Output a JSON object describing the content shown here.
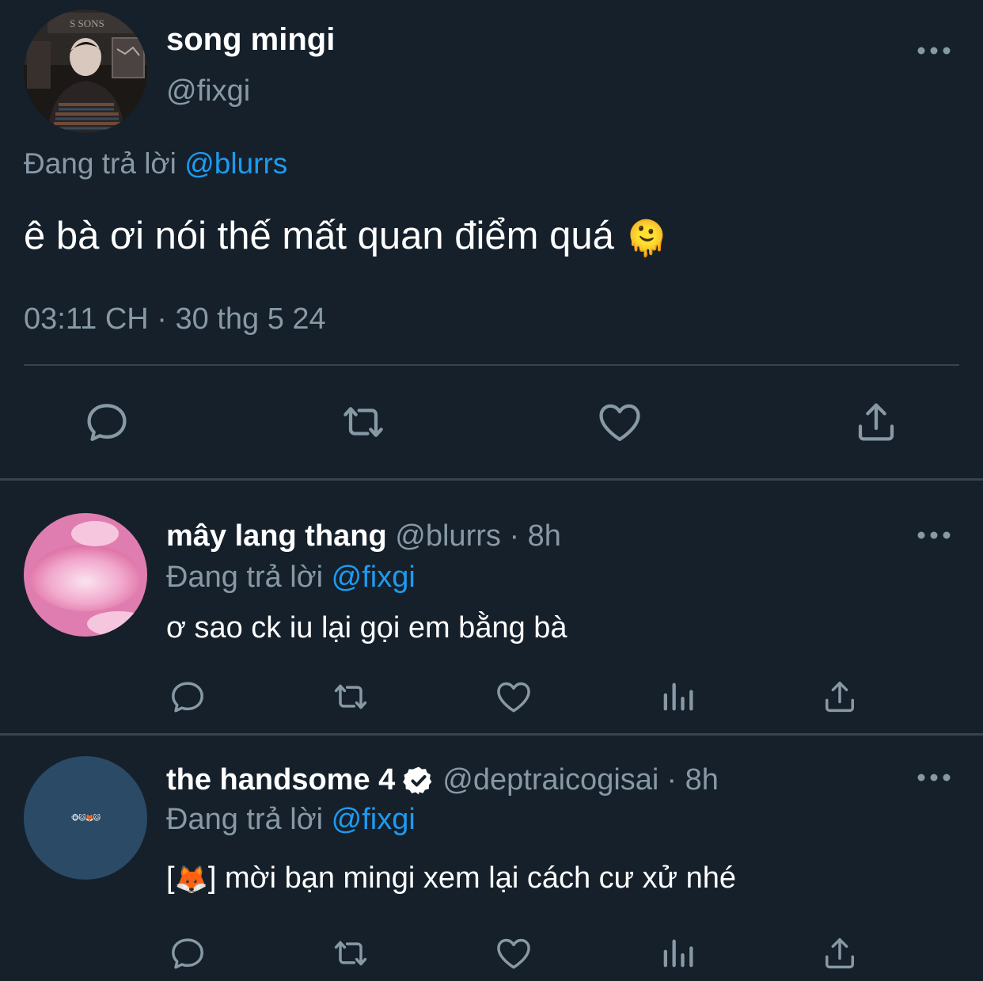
{
  "main_tweet": {
    "display_name": "song mingi",
    "handle": "@fixgi",
    "reply_prefix": "Đang trả lời",
    "reply_to": "@blurrs",
    "text": "ê bà ơi nói thế mất quan điểm quá",
    "text_emoji": "🫠",
    "timestamp": "03:11 CH · 30 thg 5 24",
    "avatar_sign_text": "S SONS",
    "actions": [
      "reply-icon",
      "retweet-icon",
      "like-icon",
      "share-icon"
    ]
  },
  "replies": [
    {
      "display_name": "mây lang thang",
      "handle": "@blurrs",
      "time": "· 8h",
      "reply_prefix": "Đang trả lời",
      "reply_to": "@fixgi",
      "text": "ơ sao ck iu lại gọi em bằng bà",
      "avatar_color": "#e8a3c4",
      "actions": [
        "reply-icon",
        "retweet-icon",
        "like-icon",
        "views-icon",
        "share-icon"
      ]
    },
    {
      "display_name": "the handsome 4",
      "verified": true,
      "handle": "@deptraicogisai",
      "time": "· 8h",
      "reply_prefix": "Đang trả lời",
      "reply_to": "@fixgi",
      "text_prefix": "[",
      "text_emoji": "🦊",
      "text": "] mời bạn mingi xem lại cách cư xử nhé",
      "avatar_color": "#2b4a66",
      "avatar_emojis": "🐵🐱🦊🐱",
      "actions": [
        "reply-icon",
        "retweet-icon",
        "like-icon",
        "views-icon",
        "share-icon"
      ]
    }
  ],
  "colors": {
    "background": "#15202b",
    "muted": "#8899a6",
    "link": "#1d9bf0",
    "divider": "#38444d"
  }
}
